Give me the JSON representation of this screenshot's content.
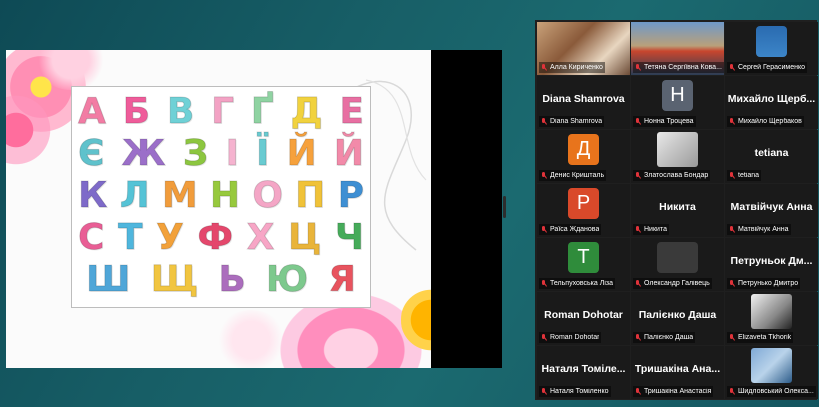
{
  "slide": {
    "rows": [
      [
        {
          "c": "А",
          "col": "#f27ca4"
        },
        {
          "c": "Б",
          "col": "#ef5c9a"
        },
        {
          "c": "В",
          "col": "#6fd1d6"
        },
        {
          "c": "Г",
          "col": "#f3a2c4"
        },
        {
          "c": "Ґ",
          "col": "#8fd3a2"
        },
        {
          "c": "Д",
          "col": "#f1d23e"
        },
        {
          "c": "Е",
          "col": "#e86fa2"
        }
      ],
      [
        {
          "c": "Є",
          "col": "#5fc2cc"
        },
        {
          "c": "Ж",
          "col": "#9b6fc9"
        },
        {
          "c": "З",
          "col": "#8cc63f"
        },
        {
          "c": "І",
          "col": "#f5b3cf"
        },
        {
          "c": "Ї",
          "col": "#69cbd1"
        },
        {
          "c": "Й",
          "col": "#f6a13c"
        },
        {
          "c": "Й",
          "col": "#f28aa9"
        }
      ],
      [
        {
          "c": "К",
          "col": "#7e6ac9"
        },
        {
          "c": "Л",
          "col": "#55c3d6"
        },
        {
          "c": "М",
          "col": "#f19c3b"
        },
        {
          "c": "Н",
          "col": "#97c93d"
        },
        {
          "c": "О",
          "col": "#f4a6c6"
        },
        {
          "c": "П",
          "col": "#f0c238"
        },
        {
          "c": "Р",
          "col": "#3e8fd3"
        }
      ],
      [
        {
          "c": "С",
          "col": "#e95e95"
        },
        {
          "c": "Т",
          "col": "#4fb6dd"
        },
        {
          "c": "У",
          "col": "#f2a13a"
        },
        {
          "c": "Ф",
          "col": "#e4476c"
        },
        {
          "c": "Х",
          "col": "#f7a6c6"
        },
        {
          "c": "Ц",
          "col": "#e9b43a"
        },
        {
          "c": "Ч",
          "col": "#46ab5a"
        }
      ],
      [
        {
          "c": "Ш",
          "col": "#4fa6d8"
        },
        {
          "c": "Щ",
          "col": "#f1c540"
        },
        {
          "c": "Ь",
          "col": "#ab6dbd"
        },
        {
          "c": "Ю",
          "col": "#7dc98d"
        },
        {
          "c": "Я",
          "col": "#e8535e"
        }
      ]
    ]
  },
  "participants": [
    {
      "name": "Алла Кириченко",
      "type": "video",
      "muted": true,
      "active": true
    },
    {
      "name": "Тетяна Сергіївна Кова...",
      "type": "video",
      "muted": true
    },
    {
      "name": "Сергей Герасименко",
      "type": "video",
      "muted": true
    },
    {
      "name": "Diana Shamrova",
      "type": "name",
      "display": "Diana Shamrova",
      "muted": true
    },
    {
      "name": "Нонна Троцева",
      "type": "avatar",
      "initial": "Н",
      "color": "#5a6371",
      "muted": true
    },
    {
      "name": "Михайло Щербаков",
      "type": "name",
      "display": "Михайло Щерб...",
      "muted": true
    },
    {
      "name": "Денис Кришталь",
      "type": "avatar",
      "initial": "Д",
      "color": "#e8741c",
      "muted": true
    },
    {
      "name": "Златослава Бондар",
      "type": "video",
      "muted": true
    },
    {
      "name": "tetiana",
      "type": "name",
      "display": "tetiana",
      "muted": true
    },
    {
      "name": "Раїса Жданова",
      "type": "avatar",
      "initial": "Р",
      "color": "#d9492a",
      "muted": true
    },
    {
      "name": "Никита",
      "type": "name",
      "display": "Никита",
      "muted": true
    },
    {
      "name": "Матвійчук Анна",
      "type": "name",
      "display": "Матвійчук Анна",
      "muted": true
    },
    {
      "name": "Тельпуховська Ліза",
      "type": "avatar",
      "initial": "Т",
      "color": "#2f8c3b",
      "muted": true
    },
    {
      "name": "Олександр Галівець",
      "type": "blank",
      "muted": true
    },
    {
      "name": "Петрунько Дмитро",
      "type": "name",
      "display": "Петруньок Дм...",
      "muted": true
    },
    {
      "name": "Roman Dohotar",
      "type": "name",
      "display": "Roman Dohotar",
      "muted": true
    },
    {
      "name": "Палієнко Даша",
      "type": "name",
      "display": "Палієнко Даша",
      "muted": true
    },
    {
      "name": "Elizaveta Tkhorik",
      "type": "video",
      "muted": true
    },
    {
      "name": "Наталя Томіленко",
      "type": "name",
      "display": "Наталя Томіле...",
      "muted": true
    },
    {
      "name": "Тришакіна Анастасія",
      "type": "name",
      "display": "Тришакіна Ана...",
      "muted": true
    },
    {
      "name": "Шидловський Олекса...",
      "type": "video",
      "muted": true
    }
  ]
}
